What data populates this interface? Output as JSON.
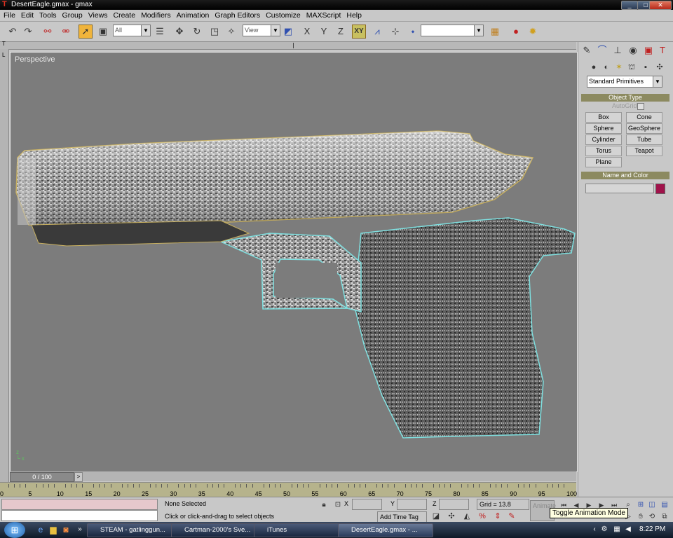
{
  "window": {
    "title": "DesertEagle.gmax - gmax"
  },
  "menu": [
    "File",
    "Edit",
    "Tools",
    "Group",
    "Views",
    "Create",
    "Modifiers",
    "Animation",
    "Graph Editors",
    "Customize",
    "MAXScript",
    "Help"
  ],
  "toolbar": {
    "selection_filter": "All",
    "coord_system": "View",
    "axis_x": "X",
    "axis_y": "Y",
    "axis_z": "Z",
    "axis_xy": "XY",
    "named_sel": ""
  },
  "viewport": {
    "label": "Perspective",
    "ruler_corner": "T",
    "vruler_corner": "L"
  },
  "time": {
    "slider": "0 / 100",
    "ticks": [
      "0",
      "5",
      "10",
      "15",
      "20",
      "25",
      "30",
      "35",
      "40",
      "45",
      "50",
      "55",
      "60",
      "65",
      "70",
      "75",
      "80",
      "85",
      "90",
      "95",
      "100"
    ]
  },
  "command_panel": {
    "category": "Standard Primitives",
    "object_type_header": "Object Type",
    "autogrid": "AutoGrid",
    "buttons": [
      "Box",
      "Cone",
      "Sphere",
      "GeoSphere",
      "Cylinder",
      "Tube",
      "Torus",
      "Teapot",
      "Plane"
    ],
    "name_color_header": "Name and Color",
    "color": "#a0124a"
  },
  "status": {
    "selection": "None Selected",
    "prompt": "Click or click-and-drag to select objects",
    "x_label": "X",
    "y_label": "Y",
    "z_label": "Z",
    "grid": "Grid = 13.8",
    "add_time_tag": "Add Time Tag",
    "animate": "Animate"
  },
  "tooltip": "Toggle Animation Mode",
  "taskbar": {
    "items": [
      "STEAM - gatlinggun...",
      "Cartman-2000's Sve...",
      "iTunes",
      "DesertEagle.gmax - ..."
    ],
    "clock": "8:22 PM"
  }
}
